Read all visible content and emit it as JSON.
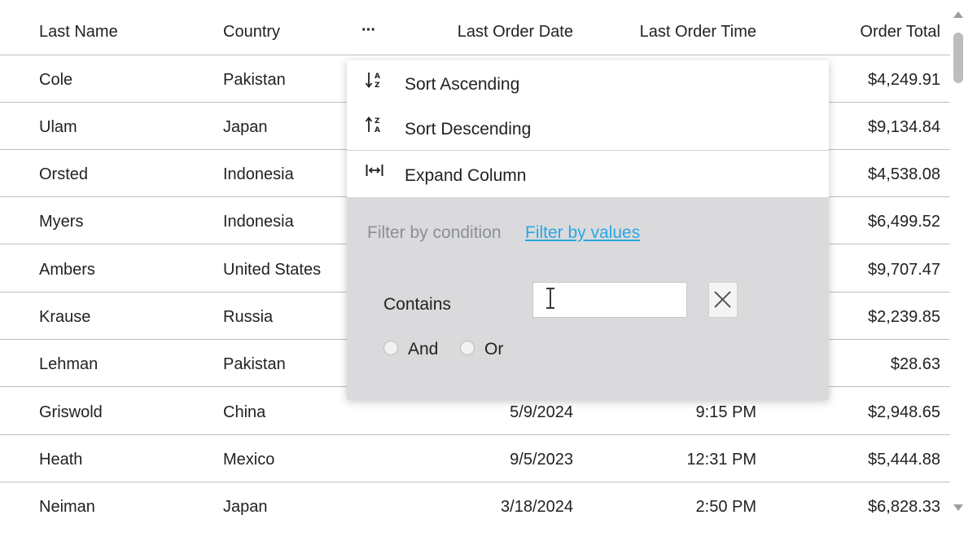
{
  "columns": {
    "last_name": "Last Name",
    "country": "Country",
    "last_order_date": "Last Order Date",
    "last_order_time": "Last Order Time",
    "order_total": "Order Total"
  },
  "more_glyph": "···",
  "rows": [
    {
      "last_name": "Cole",
      "country": "Pakistan",
      "date": "",
      "time": "",
      "total": "$4,249.91"
    },
    {
      "last_name": "Ulam",
      "country": "Japan",
      "date": "",
      "time": "",
      "total": "$9,134.84"
    },
    {
      "last_name": "Orsted",
      "country": "Indonesia",
      "date": "",
      "time": "",
      "total": "$4,538.08"
    },
    {
      "last_name": "Myers",
      "country": "Indonesia",
      "date": "",
      "time": "",
      "total": "$6,499.52"
    },
    {
      "last_name": "Ambers",
      "country": "United States",
      "date": "",
      "time": "",
      "total": "$9,707.47"
    },
    {
      "last_name": "Krause",
      "country": "Russia",
      "date": "",
      "time": "",
      "total": "$2,239.85"
    },
    {
      "last_name": "Lehman",
      "country": "Pakistan",
      "date": "",
      "time": "",
      "total": "$28.63"
    },
    {
      "last_name": "Griswold",
      "country": "China",
      "date": "5/9/2024",
      "time": "9:15 PM",
      "total": "$2,948.65"
    },
    {
      "last_name": "Heath",
      "country": "Mexico",
      "date": "9/5/2023",
      "time": "12:31 PM",
      "total": "$5,444.88"
    },
    {
      "last_name": "Neiman",
      "country": "Japan",
      "date": "3/18/2024",
      "time": "2:50 PM",
      "total": "$6,828.33"
    }
  ],
  "column_menu": {
    "sort_ascending": "Sort Ascending",
    "sort_descending": "Sort Descending",
    "expand_column": "Expand Column",
    "sort_ascending_icon": "sort-az-down-icon",
    "sort_descending_icon": "sort-za-up-icon",
    "expand_column_icon": "expand-horizontal-icon"
  },
  "filter": {
    "tab_condition": "Filter by condition",
    "tab_values": "Filter by values",
    "condition_label": "Contains",
    "value": "",
    "and_label": "And",
    "or_label": "Or"
  },
  "colors": {
    "link": "#29a7e1",
    "panel_bg": "#dadadc",
    "muted_text": "#8a8f96",
    "row_border": "#bfbfbf"
  }
}
